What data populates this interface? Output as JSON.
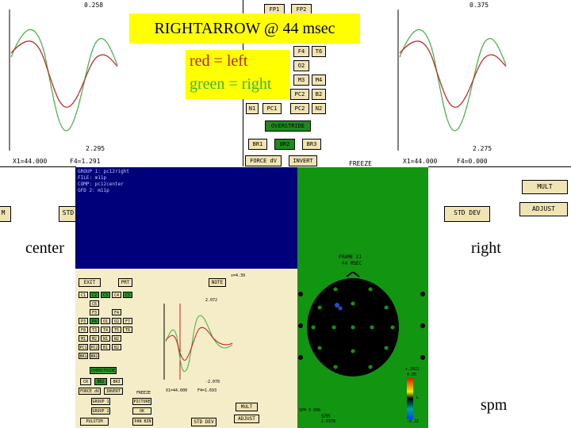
{
  "slide": {
    "title": "RIGHTARROW @ 44 msec",
    "legend_red": "red = left",
    "legend_green": "green = right",
    "label_center": "center",
    "label_right": "right",
    "label_spm": "spm"
  },
  "colors": {
    "red": "#c81e1e",
    "green": "#3cb43c",
    "panel_bg": "#f5ecc8",
    "yellow": "#ffff00",
    "blue": "#00007a",
    "head_green": "#129612"
  },
  "bg_left": {
    "value_top": "0.258",
    "value_small": "2.295",
    "x1": "X1=44.000",
    "f4": "F4=1.291",
    "std_dev": "STD",
    "m": "M"
  },
  "bg_right": {
    "value_top": "0.375",
    "value_small": "2.275",
    "x1": "X1=44.000",
    "f4": "F4=0.000",
    "std_dev": "STD DEV",
    "mult": "MULT",
    "adjust": "ADJUST"
  },
  "bg_center": {
    "buttons": [
      "FP1",
      "FP2",
      "F4",
      "T6",
      "O2",
      "M3",
      "M4",
      "PC2",
      "B2",
      "N1",
      "PC1",
      "PC2",
      "N2",
      "OVERSTRIDE",
      "BR1",
      "BR2",
      "BR3",
      "FORCE dV",
      "INVERT",
      "FREEZE"
    ]
  },
  "window": {
    "info_lines": [
      "GROUP 1: pc12right",
      "FILE: m11p",
      "COMP: pc12center",
      "GFD 2: m11p"
    ],
    "exit": "EXIT",
    "prt": "PRT",
    "note": "NOTE",
    "readout": "x=4.39",
    "channels": [
      "C1",
      "C2",
      "C3",
      "C4",
      "C5",
      "C6",
      "F3",
      "F4",
      "P3",
      "P4",
      "O1",
      "O2",
      "F7",
      "F8",
      "T3",
      "T4",
      "T5",
      "T6",
      "M1",
      "M2",
      "N1",
      "N2",
      "PC1",
      "PC2",
      "B1",
      "B2",
      "BR1",
      "BR2"
    ],
    "overstride": "OVERSTRIDE",
    "small_buttons": [
      "CR",
      "BR2",
      "BR3",
      "FORCE dV",
      "INVERT"
    ],
    "group1": "GROUP 1",
    "group2": "GROUP 2",
    "freeze": "FREEZE",
    "picture": "PICTURE",
    "ok": "OK",
    "pan_bin": "PAN BIN",
    "wave_value_top": "2.072",
    "wave_value_bottom": "-2.078",
    "x1": "X1=44.000",
    "f4": "F4=1.693",
    "mult": "MULT",
    "pulstim": "PULSTIM",
    "std_dev": "STD DEV",
    "adjust": "ADJUST",
    "frame_line1": "FRAME 11",
    "frame_line2": "44 MSEC",
    "scale_top": "+.2021",
    "scale_top2": "4.05",
    "scale_mid": "L",
    "scale_bot": "-0.22",
    "spm_label": "SPM",
    "spm_value": "2.0378",
    "bottom_text": "SPM  0.000"
  }
}
